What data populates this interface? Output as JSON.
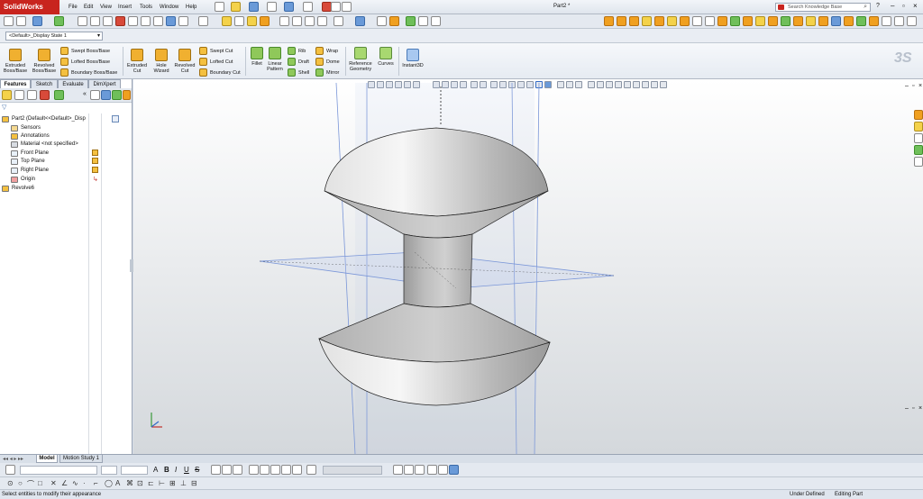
{
  "app": {
    "name": "SolidWorks",
    "title": "Part2 *"
  },
  "menus": [
    "File",
    "Edit",
    "View",
    "Insert",
    "Tools",
    "Window",
    "Help"
  ],
  "search": {
    "placeholder": "Search Knowledge Base"
  },
  "config_dropdown": "<Default>_Display State 1",
  "commands": {
    "extruded_boss": "Extruded Boss/Base",
    "revolved_boss": "Revolved Boss/Base",
    "swept_boss": "Swept Boss/Base",
    "lofted_boss": "Lofted Boss/Base",
    "boundary_boss": "Boundary Boss/Base",
    "extruded_cut": "Extruded Cut",
    "hole_wizard": "Hole Wizard",
    "revolved_cut": "Revolved Cut",
    "swept_cut": "Swept Cut",
    "lofted_cut": "Lofted Cut",
    "boundary_cut": "Boundary Cut",
    "fillet": "Fillet",
    "linear_pattern": "Linear Pattern",
    "rib": "Rib",
    "draft": "Draft",
    "shell": "Shell",
    "wrap": "Wrap",
    "dome": "Dome",
    "mirror": "Mirror",
    "reference_geometry": "Reference Geometry",
    "curves": "Curves",
    "instant3d": "Instant3D"
  },
  "manager_tabs": [
    "Features",
    "Sketch",
    "Evaluate",
    "DimXpert"
  ],
  "tree": {
    "root": "Part2 (Default<<Default>_Disp",
    "items": [
      "Sensors",
      "Annotations",
      "Material <not specified>",
      "Front Plane",
      "Top Plane",
      "Right Plane",
      "Origin",
      "Revolve6"
    ]
  },
  "bottom_tabs": [
    "Model",
    "Motion Study 1"
  ],
  "status": {
    "message": "Select entities to modify their appearance",
    "state": "Under Defined",
    "mode": "Editing Part"
  },
  "colors": {
    "accent": "#316ac5",
    "viewport_top": "#ffffff",
    "viewport_bottom": "#d4d8dc",
    "part": "#c6c6c6"
  }
}
